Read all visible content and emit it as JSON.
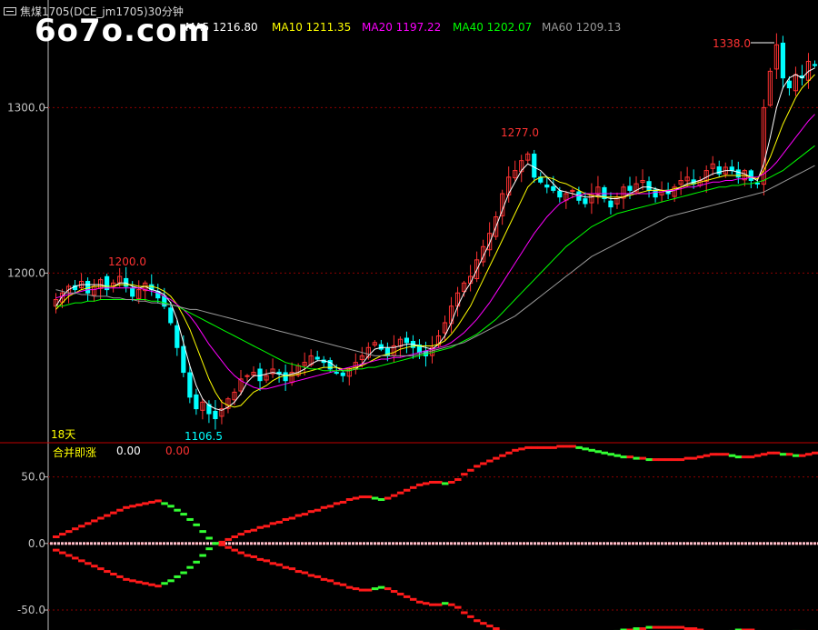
{
  "title": "焦煤1705(DCE_jm1705)30分钟",
  "watermark": "6o7o.com",
  "ma_legend": [
    {
      "label": "MA5",
      "value": "1216.80",
      "color": "#ffffff"
    },
    {
      "label": "MA10",
      "value": "1211.35",
      "color": "#ffff00"
    },
    {
      "label": "MA20",
      "value": "1197.22",
      "color": "#ff00ff"
    },
    {
      "label": "MA40",
      "value": "1202.07",
      "color": "#00ff00"
    },
    {
      "label": "MA60",
      "value": "1209.13",
      "color": "#9a9a9a"
    }
  ],
  "price_axis": {
    "ticks": [
      "1300.0",
      "1200.0"
    ]
  },
  "annotations": {
    "high_main": "1338.0",
    "high_mid": "1277.0",
    "high_left": "1200.0",
    "low": "1106.5",
    "days": "18天"
  },
  "indicator": {
    "name": "合并即涨",
    "value1": "0.00",
    "value2": "0.00",
    "ticks": [
      "50.0",
      "0.0",
      "-50.0"
    ]
  },
  "colors": {
    "up": "#ff3232",
    "down": "#00ffff",
    "grid": "#8b0000",
    "axis": "#c0c0c0"
  },
  "chart_data": {
    "type": "candlestick",
    "ylim": [
      1098,
      1342
    ],
    "closes": [
      1184,
      1188,
      1192,
      1190,
      1195,
      1188,
      1192,
      1196,
      1190,
      1194,
      1198,
      1192,
      1186,
      1190,
      1194,
      1190,
      1185,
      1180,
      1170,
      1155,
      1140,
      1125,
      1118,
      1122,
      1115,
      1112,
      1118,
      1124,
      1128,
      1136,
      1138,
      1140,
      1135,
      1138,
      1142,
      1139,
      1135,
      1140,
      1144,
      1146,
      1150,
      1148,
      1146,
      1142,
      1140,
      1138,
      1142,
      1146,
      1150,
      1155,
      1158,
      1154,
      1150,
      1156,
      1160,
      1158,
      1155,
      1152,
      1150,
      1155,
      1162,
      1170,
      1180,
      1188,
      1194,
      1198,
      1208,
      1216,
      1224,
      1234,
      1248,
      1258,
      1262,
      1268,
      1272,
      1258,
      1255,
      1252,
      1250,
      1246,
      1248,
      1250,
      1244,
      1242,
      1248,
      1252,
      1245,
      1240,
      1246,
      1252,
      1250,
      1254,
      1256,
      1250,
      1246,
      1250,
      1248,
      1252,
      1256,
      1258,
      1254,
      1256,
      1262,
      1266,
      1260,
      1264,
      1262,
      1258,
      1262,
      1256,
      1254,
      1300,
      1322,
      1338,
      1318,
      1312,
      1320,
      1318,
      1328,
      1326
    ],
    "ma_series": [
      {
        "name": "MA5",
        "values": [
          1180,
          1186,
          1190,
          1192,
          1193,
          1193,
          1193,
          1193,
          1192,
          1192,
          1194,
          1194,
          1192,
          1191,
          1192,
          1190,
          1189,
          1187,
          1182,
          1172,
          1158,
          1144,
          1132,
          1124,
          1120,
          1118,
          1117,
          1119,
          1122,
          1127,
          1134,
          1138,
          1138,
          1139,
          1140,
          1139,
          1138,
          1139,
          1140,
          1142,
          1145,
          1147,
          1147,
          1146,
          1143,
          1141,
          1141,
          1142,
          1145,
          1150,
          1154,
          1155,
          1155,
          1155,
          1156,
          1157,
          1157,
          1156,
          1155,
          1154,
          1157,
          1162,
          1170,
          1180,
          1188,
          1194,
          1202,
          1210,
          1218,
          1228,
          1238,
          1248,
          1255,
          1262,
          1266,
          1264,
          1262,
          1258,
          1254,
          1250,
          1249,
          1248,
          1247,
          1246,
          1246,
          1247,
          1246,
          1245,
          1245,
          1246,
          1248,
          1250,
          1252,
          1252,
          1251,
          1250,
          1249,
          1250,
          1252,
          1254,
          1255,
          1256,
          1258,
          1260,
          1261,
          1262,
          1262,
          1261,
          1260,
          1258,
          1256,
          1266,
          1282,
          1300,
          1312,
          1318,
          1320,
          1318,
          1322,
          1324
        ]
      },
      {
        "name": "MA10",
        "values": [
          1178,
          1182,
          1186,
          1188,
          1190,
          1191,
          1192,
          1192,
          1192,
          1192,
          1193,
          1193,
          1193,
          1192,
          1192,
          1192,
          1191,
          1189,
          1186,
          1181,
          1174,
          1166,
          1156,
          1146,
          1136,
          1128,
          1122,
          1120,
          1119,
          1120,
          1124,
          1128,
          1130,
          1132,
          1135,
          1137,
          1138,
          1138,
          1139,
          1140,
          1141,
          1142,
          1143,
          1143,
          1143,
          1142,
          1142,
          1143,
          1144,
          1146,
          1148,
          1150,
          1151,
          1152,
          1154,
          1155,
          1156,
          1156,
          1156,
          1156,
          1157,
          1159,
          1163,
          1168,
          1174,
          1180,
          1188,
          1196,
          1204,
          1212,
          1220,
          1228,
          1236,
          1244,
          1252,
          1256,
          1258,
          1258,
          1257,
          1255,
          1254,
          1252,
          1250,
          1248,
          1247,
          1246,
          1246,
          1246,
          1246,
          1246,
          1247,
          1248,
          1249,
          1250,
          1250,
          1250,
          1250,
          1251,
          1252,
          1253,
          1254,
          1255,
          1256,
          1257,
          1258,
          1259,
          1259,
          1259,
          1259,
          1258,
          1257,
          1262,
          1270,
          1280,
          1290,
          1298,
          1306,
          1312,
          1316,
          1320
        ]
      },
      {
        "name": "MA20",
        "values": [
          1185,
          1186,
          1187,
          1188,
          1189,
          1190,
          1190,
          1191,
          1191,
          1191,
          1191,
          1191,
          1191,
          1191,
          1190,
          1189,
          1188,
          1186,
          1184,
          1181,
          1178,
          1174,
          1169,
          1163,
          1157,
          1152,
          1147,
          1142,
          1138,
          1135,
          1133,
          1131,
          1130,
          1130,
          1131,
          1132,
          1133,
          1134,
          1135,
          1136,
          1137,
          1138,
          1139,
          1140,
          1141,
          1142,
          1143,
          1144,
          1145,
          1146,
          1147,
          1148,
          1148,
          1149,
          1149,
          1150,
          1151,
          1152,
          1153,
          1154,
          1155,
          1156,
          1158,
          1161,
          1164,
          1168,
          1172,
          1177,
          1182,
          1188,
          1194,
          1200,
          1206,
          1212,
          1218,
          1224,
          1229,
          1234,
          1238,
          1242,
          1244,
          1246,
          1247,
          1248,
          1248,
          1248,
          1248,
          1248,
          1248,
          1248,
          1248,
          1248,
          1248,
          1248,
          1249,
          1249,
          1250,
          1250,
          1251,
          1252,
          1252,
          1253,
          1254,
          1255,
          1255,
          1256,
          1256,
          1257,
          1257,
          1258,
          1258,
          1260,
          1263,
          1267,
          1272,
          1277,
          1282,
          1287,
          1292,
          1296
        ]
      },
      {
        "name": "MA40",
        "values": [
          1180,
          1180,
          1181,
          1182,
          1182,
          1183,
          1183,
          1184,
          1184,
          1184,
          1184,
          1184,
          1184,
          1184,
          1184,
          1183,
          1183,
          1182,
          1181,
          1180,
          1178,
          1176,
          1174,
          1172,
          1170,
          1168,
          1166,
          1164,
          1162,
          1160,
          1158,
          1156,
          1154,
          1152,
          1150,
          1148,
          1146,
          1145,
          1144,
          1143,
          1142,
          1142,
          1141,
          1141,
          1141,
          1141,
          1141,
          1142,
          1142,
          1143,
          1143,
          1144,
          1145,
          1146,
          1147,
          1148,
          1149,
          1150,
          1151,
          1152,
          1153,
          1154,
          1155,
          1157,
          1159,
          1161,
          1163,
          1166,
          1169,
          1172,
          1176,
          1180,
          1184,
          1188,
          1192,
          1196,
          1200,
          1204,
          1208,
          1212,
          1216,
          1219,
          1222,
          1225,
          1228,
          1230,
          1232,
          1234,
          1236,
          1237,
          1238,
          1239,
          1240,
          1241,
          1242,
          1243,
          1244,
          1245,
          1246,
          1247,
          1248,
          1249,
          1250,
          1251,
          1252,
          1252,
          1253,
          1253,
          1254,
          1254,
          1255,
          1256,
          1258,
          1260,
          1262,
          1265,
          1268,
          1271,
          1274,
          1277
        ]
      },
      {
        "name": "MA60",
        "values": [
          1190,
          1189,
          1188,
          1188,
          1187,
          1187,
          1186,
          1186,
          1186,
          1185,
          1185,
          1184,
          1184,
          1183,
          1183,
          1182,
          1182,
          1181,
          1181,
          1180,
          1179,
          1178,
          1178,
          1177,
          1176,
          1175,
          1174,
          1173,
          1172,
          1171,
          1170,
          1169,
          1168,
          1167,
          1166,
          1165,
          1164,
          1163,
          1162,
          1161,
          1160,
          1159,
          1158,
          1157,
          1156,
          1155,
          1154,
          1153,
          1152,
          1151,
          1150,
          1150,
          1150,
          1150,
          1150,
          1150,
          1150,
          1151,
          1152,
          1153,
          1154,
          1155,
          1156,
          1157,
          1158,
          1160,
          1162,
          1164,
          1166,
          1168,
          1170,
          1172,
          1174,
          1177,
          1180,
          1183,
          1186,
          1189,
          1192,
          1195,
          1198,
          1201,
          1204,
          1207,
          1210,
          1212,
          1214,
          1216,
          1218,
          1220,
          1222,
          1224,
          1226,
          1228,
          1230,
          1232,
          1234,
          1235,
          1236,
          1237,
          1238,
          1239,
          1240,
          1241,
          1242,
          1243,
          1244,
          1245,
          1246,
          1247,
          1248,
          1249,
          1251,
          1253,
          1255,
          1257,
          1259,
          1261,
          1263,
          1265
        ]
      }
    ],
    "indicator": {
      "ylim": [
        -65,
        75
      ],
      "upper": [
        5,
        7,
        9,
        11,
        13,
        15,
        17,
        19,
        21,
        23,
        25,
        27,
        28,
        29,
        30,
        31,
        32,
        30,
        28,
        25,
        22,
        18,
        14,
        9,
        4,
        0,
        1,
        3,
        5,
        7,
        9,
        10,
        12,
        13,
        15,
        16,
        18,
        19,
        21,
        22,
        24,
        25,
        27,
        28,
        30,
        31,
        33,
        34,
        35,
        35,
        34,
        33,
        34,
        36,
        38,
        40,
        42,
        44,
        45,
        46,
        46,
        45,
        46,
        48,
        52,
        55,
        58,
        60,
        62,
        64,
        66,
        68,
        70,
        71,
        72,
        72,
        72,
        72,
        72,
        73,
        73,
        73,
        72,
        71,
        70,
        69,
        68,
        67,
        66,
        65,
        65,
        64,
        64,
        63,
        63,
        63,
        63,
        63,
        63,
        64,
        64,
        65,
        66,
        67,
        67,
        67,
        66,
        65,
        65,
        65,
        66,
        67,
        68,
        68,
        67,
        67,
        66,
        66,
        67,
        68
      ],
      "lower": [
        -5,
        -7,
        -9,
        -11,
        -13,
        -15,
        -17,
        -19,
        -21,
        -23,
        -25,
        -27,
        -28,
        -29,
        -30,
        -31,
        -32,
        -30,
        -28,
        -25,
        -22,
        -18,
        -14,
        -9,
        -4,
        0,
        -1,
        -3,
        -5,
        -7,
        -9,
        -10,
        -12,
        -13,
        -15,
        -16,
        -18,
        -19,
        -21,
        -22,
        -24,
        -25,
        -27,
        -28,
        -30,
        -31,
        -33,
        -34,
        -35,
        -35,
        -34,
        -33,
        -34,
        -36,
        -38,
        -40,
        -42,
        -44,
        -45,
        -46,
        -46,
        -45,
        -46,
        -48,
        -52,
        -55,
        -58,
        -60,
        -62,
        -64,
        -66,
        -68,
        -70,
        -71,
        -72,
        -72,
        -72,
        -72,
        -72,
        -73,
        -73,
        -73,
        -72,
        -71,
        -70,
        -69,
        -68,
        -67,
        -66,
        -65,
        -65,
        -64,
        -64,
        -63,
        -63,
        -63,
        -63,
        -63,
        -63,
        -64,
        -64,
        -65,
        -66,
        -67,
        -67,
        -67,
        -66,
        -65,
        -65,
        -65,
        -66,
        -67,
        -68,
        -68,
        -67,
        -67,
        -66,
        -66,
        -67,
        -68
      ]
    }
  }
}
